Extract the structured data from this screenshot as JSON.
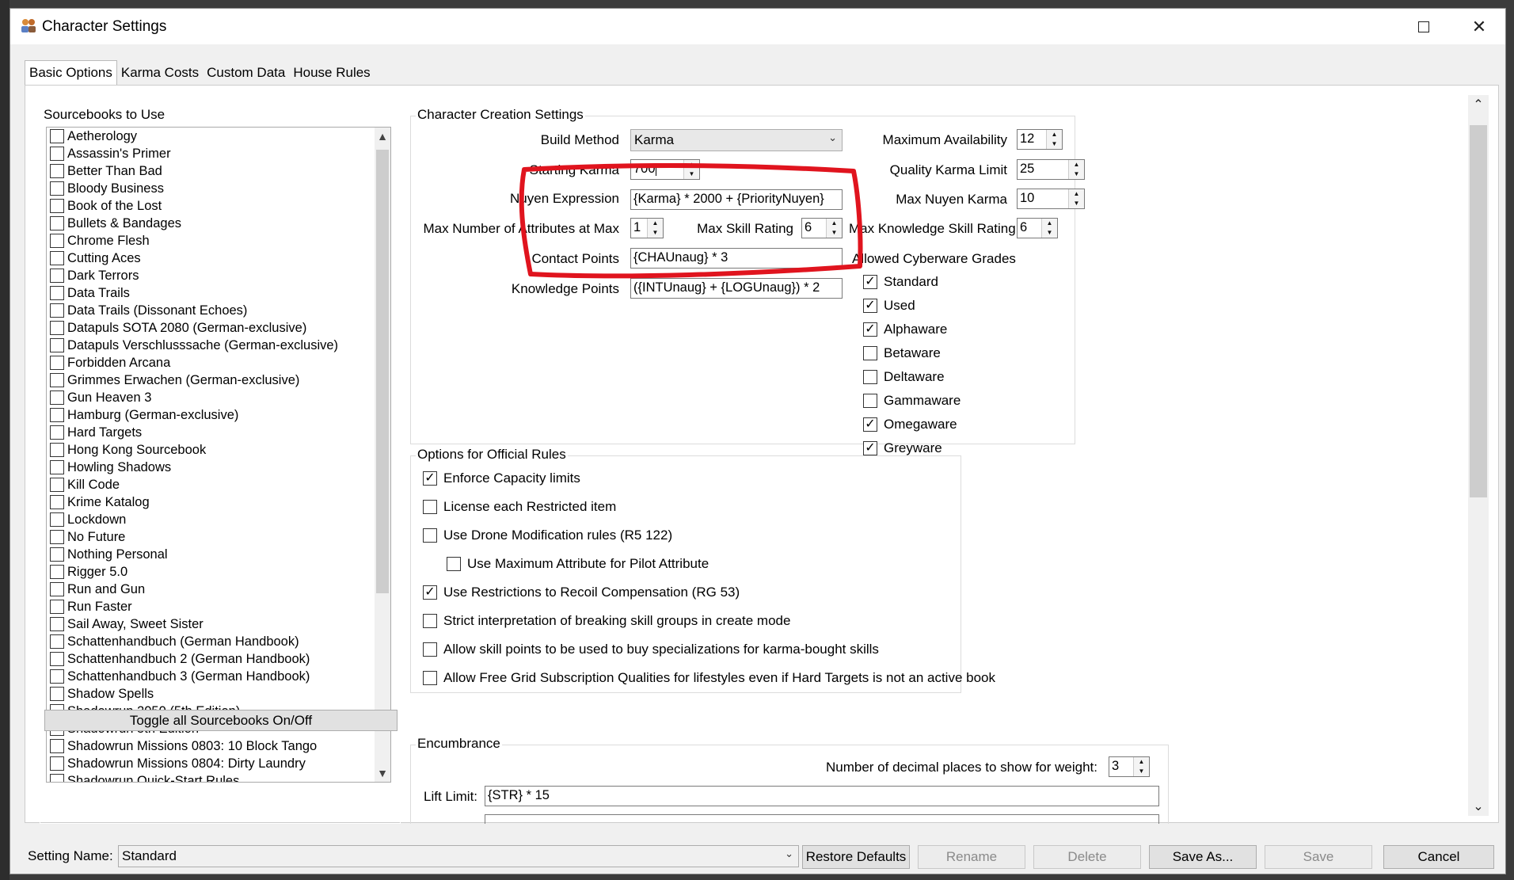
{
  "window": {
    "title": "Character Settings"
  },
  "tabs": [
    "Basic Options",
    "Karma Costs",
    "Custom Data",
    "House Rules"
  ],
  "sourcebooks": {
    "title": "Sourcebooks to Use",
    "items": [
      {
        "label": "Aetherology",
        "checked": false
      },
      {
        "label": "Assassin's Primer",
        "checked": false
      },
      {
        "label": "Better Than Bad",
        "checked": false
      },
      {
        "label": "Bloody Business",
        "checked": false
      },
      {
        "label": "Book of the Lost",
        "checked": false
      },
      {
        "label": "Bullets & Bandages",
        "checked": false
      },
      {
        "label": "Chrome Flesh",
        "checked": false
      },
      {
        "label": "Cutting Aces",
        "checked": false
      },
      {
        "label": "Dark Terrors",
        "checked": false
      },
      {
        "label": "Data Trails",
        "checked": false
      },
      {
        "label": "Data Trails (Dissonant Echoes)",
        "checked": false
      },
      {
        "label": "Datapuls SOTA 2080 (German-exclusive)",
        "checked": false
      },
      {
        "label": "Datapuls Verschlusssache (German-exclusive)",
        "checked": false
      },
      {
        "label": "Forbidden Arcana",
        "checked": false
      },
      {
        "label": "Grimmes Erwachen (German-exclusive)",
        "checked": false
      },
      {
        "label": "Gun Heaven 3",
        "checked": false
      },
      {
        "label": "Hamburg (German-exclusive)",
        "checked": false
      },
      {
        "label": "Hard Targets",
        "checked": false
      },
      {
        "label": "Hong Kong Sourcebook",
        "checked": false
      },
      {
        "label": "Howling Shadows",
        "checked": false
      },
      {
        "label": "Kill Code",
        "checked": false
      },
      {
        "label": "Krime Katalog",
        "checked": false
      },
      {
        "label": "Lockdown",
        "checked": false
      },
      {
        "label": "No Future",
        "checked": false
      },
      {
        "label": "Nothing Personal",
        "checked": false
      },
      {
        "label": "Rigger 5.0",
        "checked": false
      },
      {
        "label": "Run and Gun",
        "checked": false
      },
      {
        "label": "Run Faster",
        "checked": false
      },
      {
        "label": "Sail Away, Sweet Sister",
        "checked": false
      },
      {
        "label": "Schattenhandbuch (German Handbook)",
        "checked": false
      },
      {
        "label": "Schattenhandbuch 2 (German Handbook)",
        "checked": false
      },
      {
        "label": "Schattenhandbuch 3 (German Handbook)",
        "checked": false
      },
      {
        "label": "Shadow Spells",
        "checked": false
      },
      {
        "label": "Shadowrun 2050 (5th Edition)",
        "checked": false
      },
      {
        "label": "Shadowrun 5th Edition",
        "checked": true
      },
      {
        "label": "Shadowrun Missions 0803: 10 Block Tango",
        "checked": false
      },
      {
        "label": "Shadowrun Missions 0804: Dirty Laundry",
        "checked": false
      },
      {
        "label": "Shadowrun Quick-Start Rules",
        "checked": false
      }
    ],
    "toggle_button": "Toggle all Sourcebooks On/Off"
  },
  "creation": {
    "title": "Character Creation Settings",
    "build_method_label": "Build Method",
    "build_method_value": "Karma",
    "starting_karma_label": "Starting Karma",
    "starting_karma_value": "700",
    "nuyen_expression_label": "Nuyen Expression",
    "nuyen_expression_value": "{Karma} * 2000 + {PriorityNuyen}",
    "max_attr_label": "Max Number of Attributes at Max",
    "max_attr_value": "1",
    "max_skill_label": "Max Skill Rating",
    "max_skill_value": "6",
    "max_knowledge_label": "Max Knowledge Skill Rating",
    "max_knowledge_value": "6",
    "contact_points_label": "Contact Points",
    "contact_points_value": "{CHAUnaug} * 3",
    "knowledge_points_label": "Knowledge Points",
    "knowledge_points_value": "({INTUnaug} + {LOGUnaug}) * 2",
    "max_availability_label": "Maximum Availability",
    "max_availability_value": "12",
    "quality_karma_label": "Quality Karma Limit",
    "quality_karma_value": "25",
    "max_nuyen_karma_label": "Max Nuyen Karma",
    "max_nuyen_karma_value": "10",
    "cyberware_label": "Allowed Cyberware Grades",
    "cyberware_grades": [
      {
        "label": "Standard",
        "checked": true
      },
      {
        "label": "Used",
        "checked": true
      },
      {
        "label": "Alphaware",
        "checked": true
      },
      {
        "label": "Betaware",
        "checked": false
      },
      {
        "label": "Deltaware",
        "checked": false
      },
      {
        "label": "Gammaware",
        "checked": false
      },
      {
        "label": "Omegaware",
        "checked": true
      },
      {
        "label": "Greyware",
        "checked": true
      }
    ]
  },
  "official_rules": {
    "title": "Options for Official Rules",
    "options": [
      {
        "label": "Enforce Capacity limits",
        "checked": true
      },
      {
        "label": "License each Restricted item",
        "checked": false
      },
      {
        "label": "Use Drone Modification rules (R5 122)",
        "checked": false
      },
      {
        "label": "Use Maximum Attribute for Pilot Attribute",
        "checked": false
      },
      {
        "label": "Use Restrictions to Recoil Compensation (RG 53)",
        "checked": true
      },
      {
        "label": "Strict interpretation of breaking skill groups in create mode",
        "checked": false
      },
      {
        "label": "Allow skill points to be used to buy specializations for karma-bought skills",
        "checked": false
      },
      {
        "label": "Allow Free Grid Subscription Qualities for lifestyles even if Hard Targets is not an active book",
        "checked": false
      }
    ]
  },
  "encumbrance": {
    "title": "Encumbrance",
    "decimal_label": "Number of decimal places to show for weight:",
    "decimal_value": "3",
    "lift_limit_label": "Lift Limit:",
    "lift_limit_value": "{STR} * 15"
  },
  "footer": {
    "setting_name_label": "Setting Name:",
    "setting_name_value": "Standard",
    "restore_defaults": "Restore Defaults",
    "rename": "Rename",
    "delete": "Delete",
    "save_as": "Save As...",
    "save": "Save",
    "cancel": "Cancel"
  },
  "colors": {
    "annotation": "#e0141e",
    "window_bg": "#f0f0f0",
    "pane_bg": "#ffffff"
  }
}
